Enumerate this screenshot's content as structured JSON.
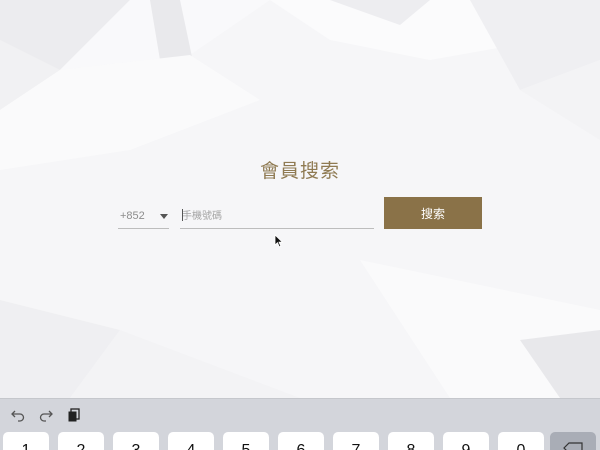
{
  "theme": {
    "accent": "#8a7248",
    "title_color": "#8f7a52",
    "background": "#f6f6f8"
  },
  "member_search": {
    "title": "會員搜索",
    "country_code": "+852",
    "phone_placeholder": "手機號碼",
    "phone_value": "",
    "search_label": "搜索"
  },
  "keyboard": {
    "toolbar": [
      "undo-icon",
      "redo-icon",
      "paste-icon"
    ],
    "keys": [
      "1",
      "2",
      "3",
      "4",
      "5",
      "6",
      "7",
      "8",
      "9",
      "0"
    ]
  }
}
